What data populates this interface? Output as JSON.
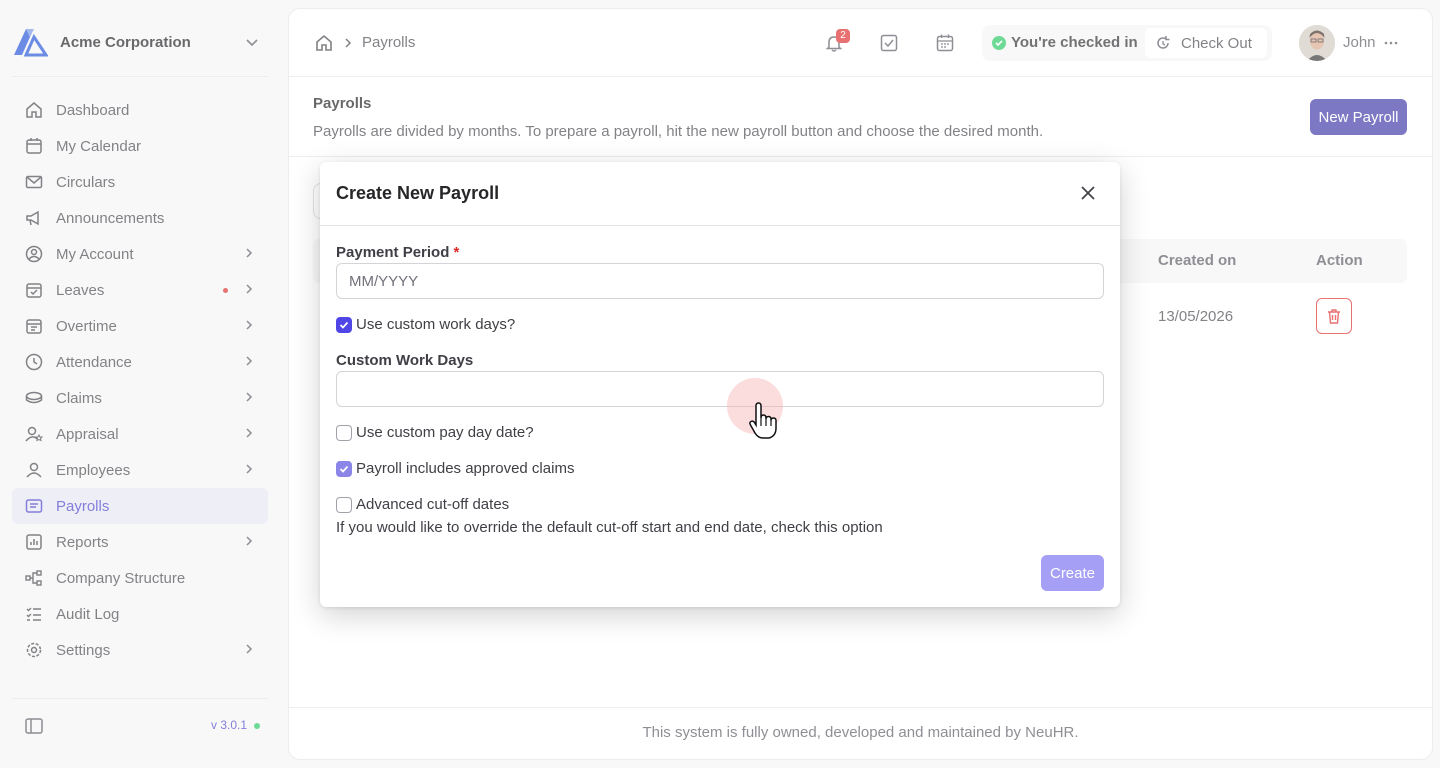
{
  "org": {
    "name": "Acme Corporation"
  },
  "sidebar": {
    "items": [
      {
        "label": "Dashboard",
        "icon": "home-icon"
      },
      {
        "label": "My Calendar",
        "icon": "calendar-icon"
      },
      {
        "label": "Circulars",
        "icon": "mail-icon"
      },
      {
        "label": "Announcements",
        "icon": "megaphone-icon"
      },
      {
        "label": "My Account",
        "icon": "user-circle-icon"
      },
      {
        "label": "Leaves",
        "icon": "calendar-check-icon"
      },
      {
        "label": "Overtime",
        "icon": "calendar-clock-icon"
      },
      {
        "label": "Attendance",
        "icon": "clock-icon"
      },
      {
        "label": "Claims",
        "icon": "coins-icon"
      },
      {
        "label": "Appraisal",
        "icon": "user-star-icon"
      },
      {
        "label": "Employees",
        "icon": "user-icon"
      },
      {
        "label": "Payrolls",
        "icon": "payroll-icon"
      },
      {
        "label": "Reports",
        "icon": "report-icon"
      },
      {
        "label": "Company Structure",
        "icon": "hierarchy-icon"
      },
      {
        "label": "Audit Log",
        "icon": "list-check-icon"
      },
      {
        "label": "Settings",
        "icon": "gear-icon"
      }
    ],
    "version": "v 3.0.1"
  },
  "topbar": {
    "breadcrumb": "Payrolls",
    "notifications": "2",
    "checkin_status": "You're checked in",
    "checkout_label": "Check Out",
    "user_name": "John"
  },
  "page": {
    "title": "Payrolls",
    "description": "Payrolls are divided by months. To prepare a payroll, hit the new payroll button and choose the desired month.",
    "new_button": "New Payroll",
    "table": {
      "headers": {
        "created": "Created on",
        "action": "Action"
      },
      "rows": [
        {
          "created": "13/05/2026"
        }
      ]
    },
    "footer": "This system is fully owned, developed and maintained by NeuHR."
  },
  "modal": {
    "title": "Create New Payroll",
    "payment_period_label": "Payment Period",
    "required_mark": "*",
    "payment_period_placeholder": "MM/YYYY",
    "cb_custom_work_days": "Use custom work days?",
    "custom_work_days_label": "Custom Work Days",
    "custom_work_days_value": "",
    "cb_custom_pay_day": "Use custom pay day date?",
    "cb_includes_claims": "Payroll includes approved claims",
    "cb_advanced_cutoff": "Advanced cut-off dates",
    "hint": "If you would like to override the default cut-off start and end date, check this option",
    "create_button": "Create"
  },
  "colors": {
    "accent": "#3730a3",
    "danger": "#dc2626",
    "success": "#22c55e"
  }
}
